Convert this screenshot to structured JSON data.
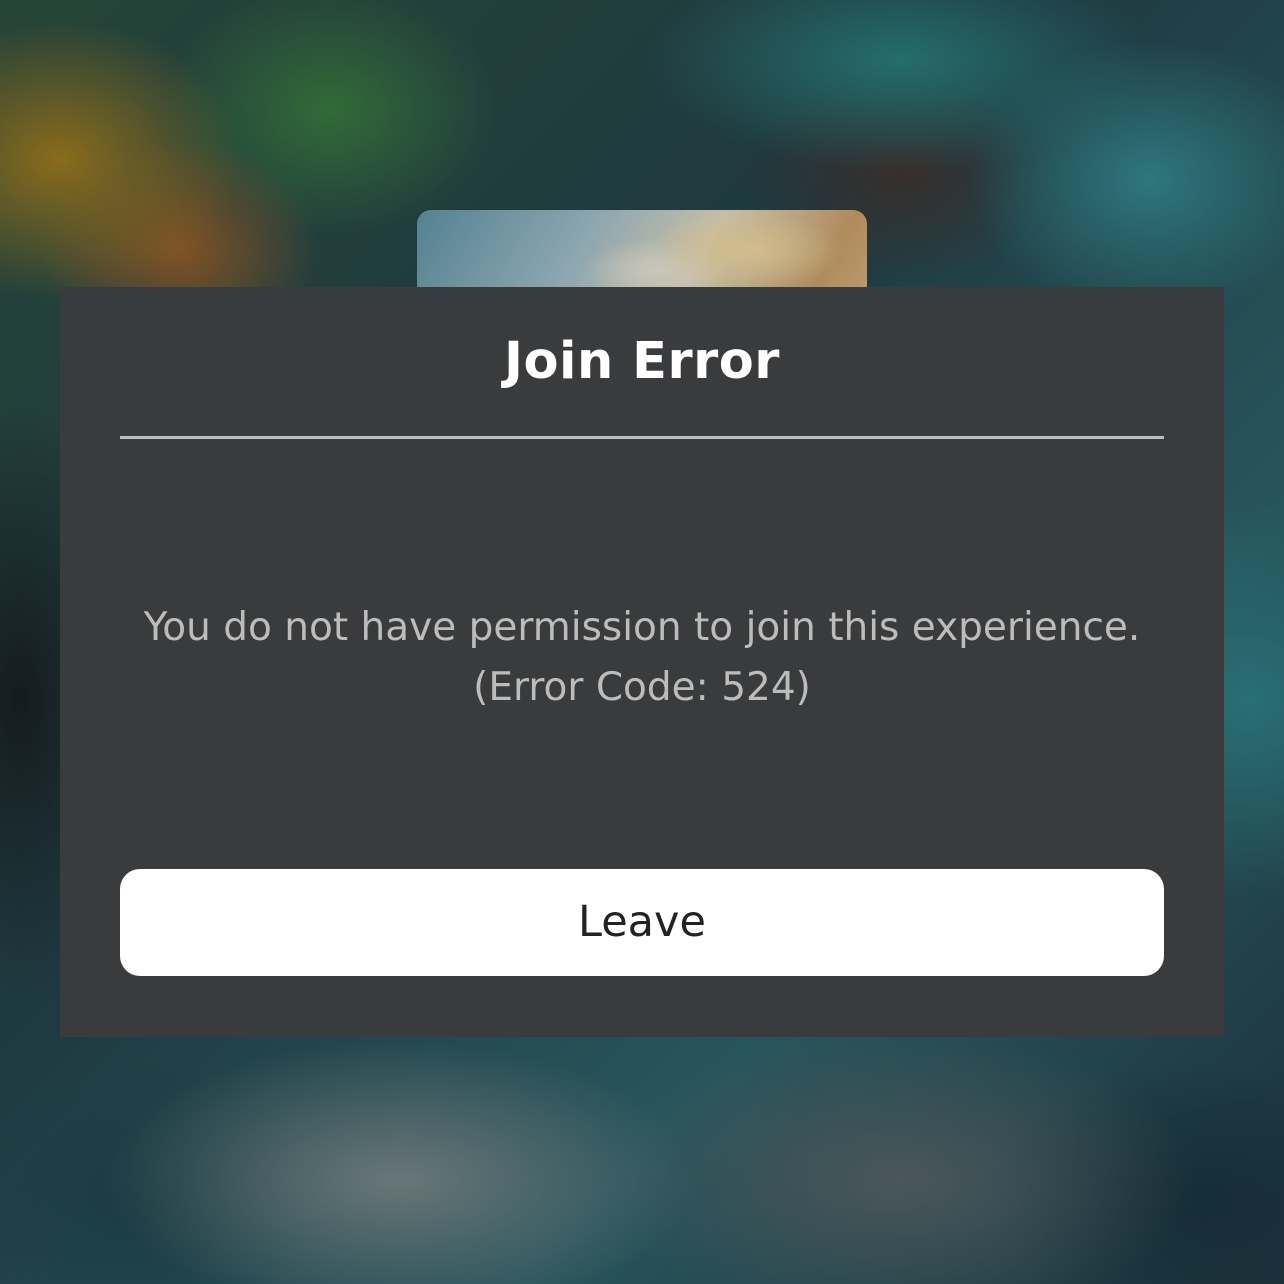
{
  "dialog": {
    "title": "Join Error",
    "message_line1": "You do not have permission to join this experience.",
    "message_line2": "(Error Code: 524)",
    "leave_label": "Leave"
  },
  "colors": {
    "dialog_background": "#393b3d",
    "title_text": "#ffffff",
    "message_text": "#bcbcbc",
    "divider": "#bdbdbd",
    "button_background": "#ffffff",
    "button_text": "#222222"
  }
}
